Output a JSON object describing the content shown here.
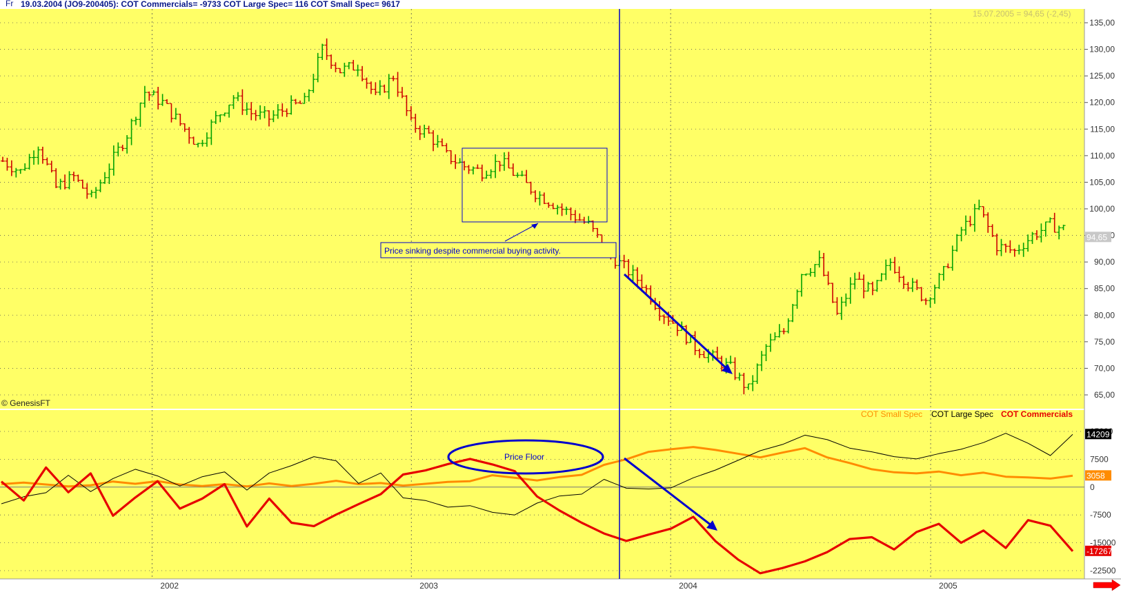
{
  "header": {
    "prefix": "Fr",
    "info": "19.03.2004 (JO9-200405):  COT Commercials= -9733  COT Large Spec= 116  COT Small Spec= 9617",
    "quote": "15.07.2005 = 94,65 (-2,45)"
  },
  "copyright": "© GenesisFT",
  "annotations": {
    "price_note": "Price sinking despite commercial buying activity.",
    "price_floor": "Price Floor"
  },
  "legend": [
    {
      "label": "COT Small Spec",
      "color": "#ff8c00"
    },
    {
      "label": "COT Large Spec",
      "color": "#000000"
    },
    {
      "label": "COT Commercials",
      "color": "#e60000"
    }
  ],
  "colors": {
    "background": "#ffff66",
    "up_bar": "#00a000",
    "down_bar": "#cc0000",
    "annotation": "#0000cc",
    "arrow_button": "#ff0000"
  },
  "chart_data": [
    {
      "type": "bar",
      "title": "",
      "subtype": "ohlc",
      "x_ticks": [
        "2002",
        "2003",
        "2004",
        "2005"
      ],
      "y_ticks": [
        "135,00",
        "130,00",
        "125,00",
        "120,00",
        "115,00",
        "110,00",
        "105,00",
        "100,00",
        "95,00",
        "90,00",
        "85,00",
        "80,00",
        "75,00",
        "70,00",
        "65,00"
      ],
      "ylim": [
        64,
        136
      ],
      "last_value_label": "94,65",
      "x": [
        "2001-07",
        "2001-08",
        "2001-09",
        "2001-10",
        "2001-11",
        "2001-12",
        "2002-01",
        "2002-02",
        "2002-03",
        "2002-04",
        "2002-05",
        "2002-06",
        "2002-07",
        "2002-08",
        "2002-09",
        "2002-10",
        "2002-11",
        "2002-12",
        "2003-01",
        "2003-02",
        "2003-03",
        "2003-04",
        "2003-05",
        "2003-06",
        "2003-07",
        "2003-08",
        "2003-09",
        "2003-10",
        "2003-11",
        "2003-12",
        "2004-01",
        "2004-02",
        "2004-03",
        "2004-04",
        "2004-05",
        "2004-06",
        "2004-07",
        "2004-08",
        "2004-09",
        "2004-10",
        "2004-11",
        "2004-12",
        "2005-01",
        "2005-02",
        "2005-03",
        "2005-04",
        "2005-05",
        "2005-06",
        "2005-07"
      ],
      "close": [
        109,
        107,
        112,
        104,
        106,
        102,
        108,
        114,
        122,
        120,
        116,
        112,
        117,
        121,
        118,
        117,
        119,
        120,
        130,
        126,
        127,
        121,
        125,
        116,
        114,
        110,
        108,
        107,
        109,
        106,
        103,
        101,
        99,
        97,
        92,
        89,
        86,
        81,
        78,
        74,
        72,
        70,
        66,
        74,
        77,
        88,
        90,
        80,
        87,
        84,
        90,
        86,
        83,
        88,
        96,
        100,
        93,
        92,
        95,
        97,
        96
      ],
      "markers": {
        "vertical_line_x": "2003-09-24"
      },
      "annotation_box": {
        "x_range": [
          "2003-02",
          "2003-09"
        ],
        "y_range": [
          97.5,
          111.5
        ]
      }
    },
    {
      "type": "line",
      "title": "",
      "y_ticks": [
        "15000",
        "7500",
        "0",
        "-7500",
        "-15000",
        "-22500"
      ],
      "ylim": [
        -22500,
        15000
      ],
      "series": [
        {
          "name": "COT Small Spec",
          "last_label": "3058",
          "values": [
            800,
            1200,
            700,
            200,
            500,
            1500,
            900,
            1600,
            700,
            300,
            800,
            200,
            1000,
            300,
            900,
            1700,
            800,
            1100,
            400,
            900,
            1400,
            1600,
            3200,
            2500,
            1800,
            2700,
            3300,
            6000,
            7500,
            9500,
            10200,
            10800,
            10000,
            9000,
            8000,
            9300,
            10500,
            8000,
            6500,
            4800,
            4000,
            3700,
            4200,
            3200,
            3900,
            2800,
            2600,
            2300,
            3058
          ]
        },
        {
          "name": "COT Large Spec",
          "last_label": "14209",
          "values": [
            -4500,
            -2600,
            -1500,
            3200,
            -1200,
            2300,
            4800,
            3000,
            300,
            2800,
            4100,
            -800,
            3800,
            5800,
            8200,
            7100,
            1000,
            3800,
            -2900,
            -3600,
            -5400,
            -5000,
            -6800,
            -7500,
            -4300,
            -2400,
            -1900,
            2100,
            -300,
            -500,
            -200,
            2500,
            4600,
            7200,
            9800,
            11500,
            14000,
            12800,
            10500,
            9500,
            8200,
            7600,
            9000,
            10200,
            12000,
            14500,
            11800,
            8500,
            14209
          ]
        },
        {
          "name": "COT Commercials",
          "last_label": "-17267",
          "values": [
            1500,
            -3600,
            5300,
            -1400,
            3700,
            -7700,
            -2800,
            1600,
            -5800,
            -3100,
            800,
            -10600,
            -3100,
            -9600,
            -10500,
            -7400,
            -4600,
            -1900,
            3400,
            4500,
            6200,
            7600,
            6100,
            4300,
            -2500,
            -6300,
            -9600,
            -12500,
            -14500,
            -12800,
            -11200,
            -8000,
            -14600,
            -19500,
            -23200,
            -21800,
            -20000,
            -17500,
            -14000,
            -13500,
            -16800,
            -12100,
            -9900,
            -15000,
            -11700,
            -16400,
            -8900,
            -10400,
            -17267
          ]
        }
      ],
      "annotation_ellipse_label": "Price Floor"
    }
  ]
}
